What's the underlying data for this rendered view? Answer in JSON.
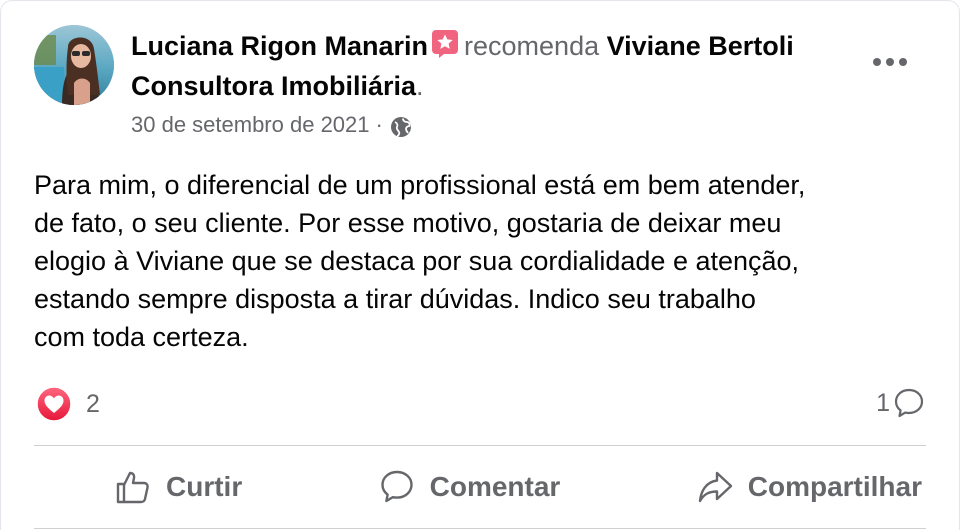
{
  "post": {
    "author": "Luciana Rigon Manarin",
    "recommends_text": "recomenda",
    "page": "Viviane Bertoli Consultora Imobiliária",
    "period": ".",
    "date": "30 de setembro de 2021",
    "date_separator": "·",
    "audience_icon": "globe-icon",
    "text_lines": [
      "Para mim, o diferencial de um profissional está em bem atender,",
      "de fato, o seu cliente. Por esse motivo, gostaria de deixar meu",
      "elogio à Viviane que se destaca por sua cordialidade e atenção,",
      "estando sempre disposta a tirar dúvidas. Indico seu trabalho",
      "com toda certeza."
    ],
    "reaction_count": "2",
    "reaction_icon": "love-reaction-icon",
    "comment_count": "1"
  },
  "actions": {
    "like_label": "Curtir",
    "comment_label": "Comentar",
    "share_label": "Compartilhar"
  },
  "colors": {
    "text_primary": "#050505",
    "text_secondary": "#65676b",
    "love_red": "#f33e58",
    "recommend_badge": "#f0647f",
    "divider": "#ced0d4"
  }
}
